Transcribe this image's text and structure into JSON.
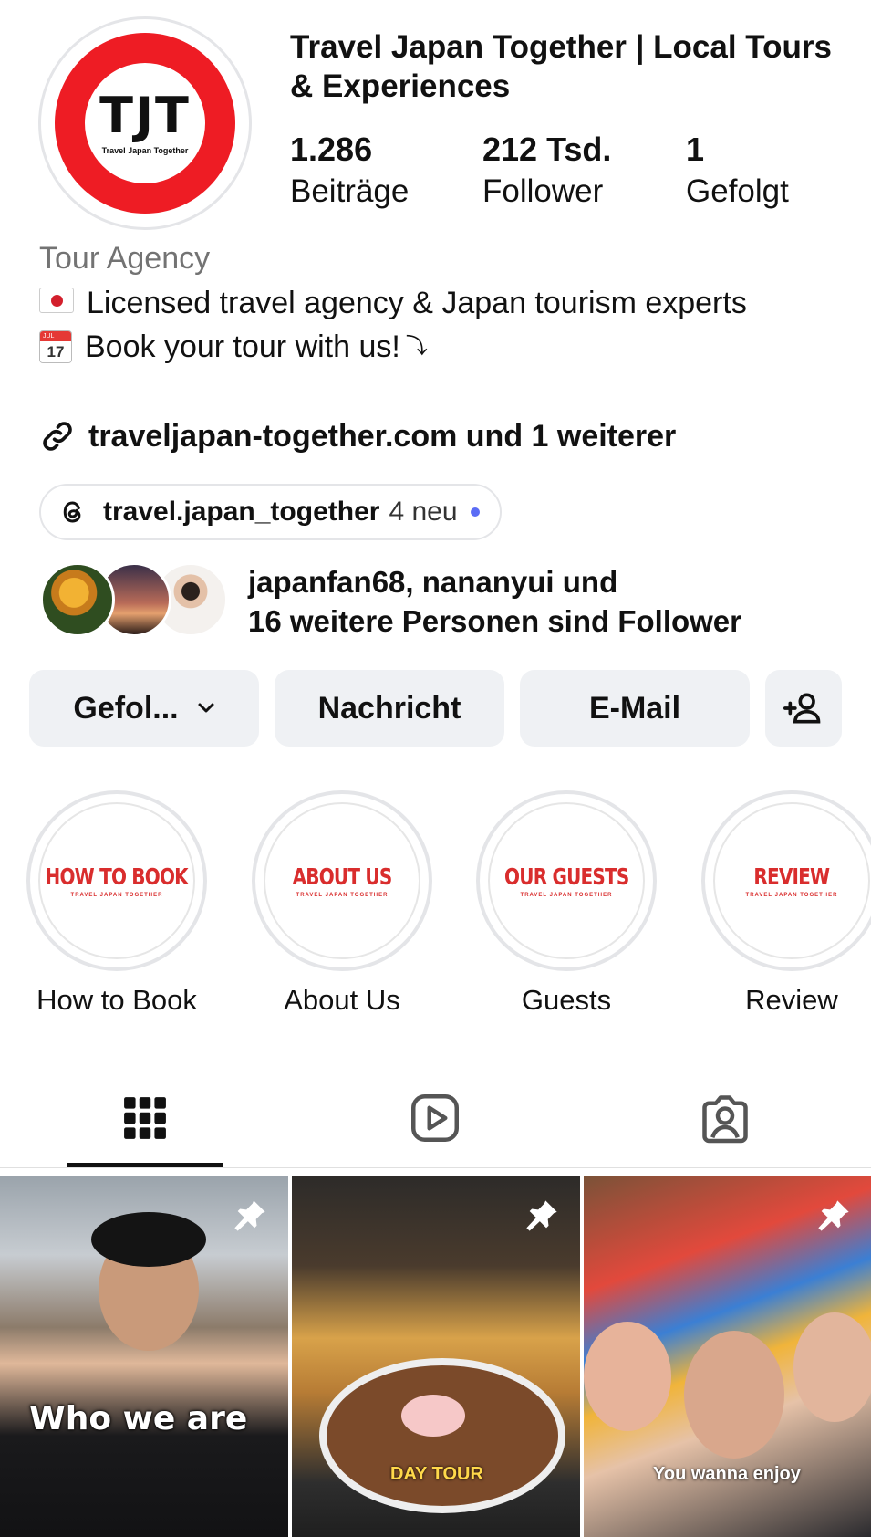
{
  "profile": {
    "name": "Travel Japan Together | Local Tours & Experiences",
    "avatar_text": "TJT",
    "avatar_subtext": "Travel Japan Together",
    "avatar_color": "#ee1c24"
  },
  "stats": {
    "posts": {
      "value": "1.286",
      "label": "Beiträge"
    },
    "followers": {
      "value": "212 Tsd.",
      "label": "Follower"
    },
    "following": {
      "value": "1",
      "label": "Gefolgt"
    }
  },
  "bio": {
    "category": "Tour Agency",
    "line1": "Licensed travel agency & Japan tourism experts",
    "line2": "Book your tour with us!",
    "line2_arrow": "⤵",
    "calendar_month": "JUL",
    "calendar_day": "17",
    "line1_icon": "japan-flag-icon",
    "line2_icon": "calendar-icon"
  },
  "link": {
    "text": "traveljapan-together.com und 1 weiterer",
    "icon": "link-icon"
  },
  "threads": {
    "handle": "travel.japan_together",
    "new_count": "4 neu",
    "dot_color": "#5b6cf5"
  },
  "followed_by": {
    "line1": "japanfan68, nananyui und",
    "line2": "16 weitere Personen sind Follower"
  },
  "actions": {
    "follow": "Gefol...",
    "message": "Nachricht",
    "email": "E-Mail",
    "add_icon": "add-person-icon"
  },
  "highlights": [
    {
      "cover_title": "HOW TO BOOK",
      "cover_sub": "TRAVEL JAPAN TOGETHER",
      "label": "How to Book"
    },
    {
      "cover_title": "ABOUT US",
      "cover_sub": "TRAVEL JAPAN TOGETHER",
      "label": "About Us"
    },
    {
      "cover_title": "OUR GUESTS",
      "cover_sub": "TRAVEL JAPAN TOGETHER",
      "label": "Guests"
    },
    {
      "cover_title": "REVIEW",
      "cover_sub": "TRAVEL JAPAN TOGETHER",
      "label": "Review"
    }
  ],
  "tabs": [
    {
      "icon": "grid-icon",
      "active": true
    },
    {
      "icon": "reels-icon",
      "active": false
    },
    {
      "icon": "tagged-icon",
      "active": false
    }
  ],
  "posts": [
    {
      "caption": "Who we are",
      "pinned": true
    },
    {
      "caption": "DAY TOUR",
      "pinned": true
    },
    {
      "caption": "You wanna enjoy",
      "pinned": true
    }
  ]
}
